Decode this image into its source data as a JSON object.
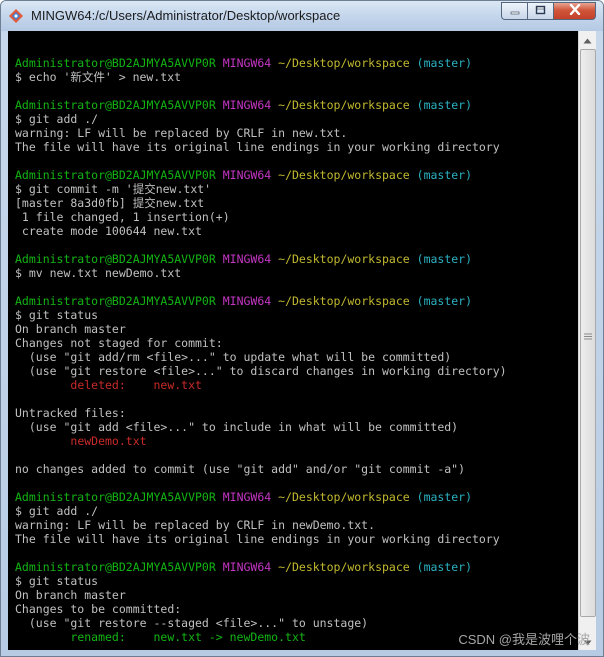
{
  "window": {
    "title": "MINGW64:/c/Users/Administrator/Desktop/workspace"
  },
  "icons": {
    "app": "git-bash-diamond-icon",
    "minimize": "minimize-icon",
    "maximize": "maximize-icon",
    "close": "close-icon",
    "scroll_up": "scroll-up-arrow-icon",
    "scroll_down": "scroll-down-arrow-icon"
  },
  "colors": {
    "prompt_user": "#13b513",
    "prompt_shell": "#c436c4",
    "prompt_path": "#c2b92f",
    "prompt_branch": "#2bb1c1",
    "git_status_highlight": "#c92a2a",
    "default_text": "#c0c0c0",
    "background": "#000000"
  },
  "terminal": {
    "lines": [
      [],
      [
        {
          "t": "Administrator@BD2AJMYA5AVVP0R",
          "c": "green"
        },
        {
          "t": " "
        },
        {
          "t": "MINGW64",
          "c": "magenta"
        },
        {
          "t": " "
        },
        {
          "t": "~/Desktop/workspace",
          "c": "yellow"
        },
        {
          "t": " "
        },
        {
          "t": "(master)",
          "c": "cyan"
        }
      ],
      [
        {
          "t": "$ echo '新文件' > new.txt"
        }
      ],
      [],
      [
        {
          "t": "Administrator@BD2AJMYA5AVVP0R",
          "c": "green"
        },
        {
          "t": " "
        },
        {
          "t": "MINGW64",
          "c": "magenta"
        },
        {
          "t": " "
        },
        {
          "t": "~/Desktop/workspace",
          "c": "yellow"
        },
        {
          "t": " "
        },
        {
          "t": "(master)",
          "c": "cyan"
        }
      ],
      [
        {
          "t": "$ git add ./"
        }
      ],
      [
        {
          "t": "warning: LF will be replaced by CRLF in new.txt."
        }
      ],
      [
        {
          "t": "The file will have its original line endings in your working directory"
        }
      ],
      [],
      [
        {
          "t": "Administrator@BD2AJMYA5AVVP0R",
          "c": "green"
        },
        {
          "t": " "
        },
        {
          "t": "MINGW64",
          "c": "magenta"
        },
        {
          "t": " "
        },
        {
          "t": "~/Desktop/workspace",
          "c": "yellow"
        },
        {
          "t": " "
        },
        {
          "t": "(master)",
          "c": "cyan"
        }
      ],
      [
        {
          "t": "$ git commit -m '提交new.txt'"
        }
      ],
      [
        {
          "t": "[master 8a3d0fb] 提交new.txt"
        }
      ],
      [
        {
          "t": " 1 file changed, 1 insertion(+)"
        }
      ],
      [
        {
          "t": " create mode 100644 new.txt"
        }
      ],
      [],
      [
        {
          "t": "Administrator@BD2AJMYA5AVVP0R",
          "c": "green"
        },
        {
          "t": " "
        },
        {
          "t": "MINGW64",
          "c": "magenta"
        },
        {
          "t": " "
        },
        {
          "t": "~/Desktop/workspace",
          "c": "yellow"
        },
        {
          "t": " "
        },
        {
          "t": "(master)",
          "c": "cyan"
        }
      ],
      [
        {
          "t": "$ mv new.txt newDemo.txt"
        }
      ],
      [],
      [
        {
          "t": "Administrator@BD2AJMYA5AVVP0R",
          "c": "green"
        },
        {
          "t": " "
        },
        {
          "t": "MINGW64",
          "c": "magenta"
        },
        {
          "t": " "
        },
        {
          "t": "~/Desktop/workspace",
          "c": "yellow"
        },
        {
          "t": " "
        },
        {
          "t": "(master)",
          "c": "cyan"
        }
      ],
      [
        {
          "t": "$ git status"
        }
      ],
      [
        {
          "t": "On branch master"
        }
      ],
      [
        {
          "t": "Changes not staged for commit:"
        }
      ],
      [
        {
          "t": "  (use \"git add/rm <file>...\" to update what will be committed)"
        }
      ],
      [
        {
          "t": "  (use \"git restore <file>...\" to discard changes in working directory)"
        }
      ],
      [
        {
          "t": "        "
        },
        {
          "t": "deleted:    new.txt",
          "c": "red"
        }
      ],
      [],
      [
        {
          "t": "Untracked files:"
        }
      ],
      [
        {
          "t": "  (use \"git add <file>...\" to include in what will be committed)"
        }
      ],
      [
        {
          "t": "        "
        },
        {
          "t": "newDemo.txt",
          "c": "red"
        }
      ],
      [],
      [
        {
          "t": "no changes added to commit (use \"git add\" and/or \"git commit -a\")"
        }
      ],
      [],
      [
        {
          "t": "Administrator@BD2AJMYA5AVVP0R",
          "c": "green"
        },
        {
          "t": " "
        },
        {
          "t": "MINGW64",
          "c": "magenta"
        },
        {
          "t": " "
        },
        {
          "t": "~/Desktop/workspace",
          "c": "yellow"
        },
        {
          "t": " "
        },
        {
          "t": "(master)",
          "c": "cyan"
        }
      ],
      [
        {
          "t": "$ git add ./"
        }
      ],
      [
        {
          "t": "warning: LF will be replaced by CRLF in newDemo.txt."
        }
      ],
      [
        {
          "t": "The file will have its original line endings in your working directory"
        }
      ],
      [],
      [
        {
          "t": "Administrator@BD2AJMYA5AVVP0R",
          "c": "green"
        },
        {
          "t": " "
        },
        {
          "t": "MINGW64",
          "c": "magenta"
        },
        {
          "t": " "
        },
        {
          "t": "~/Desktop/workspace",
          "c": "yellow"
        },
        {
          "t": " "
        },
        {
          "t": "(master)",
          "c": "cyan"
        }
      ],
      [
        {
          "t": "$ git status"
        }
      ],
      [
        {
          "t": "On branch master"
        }
      ],
      [
        {
          "t": "Changes to be committed:"
        }
      ],
      [
        {
          "t": "  (use \"git restore --staged <file>...\" to unstage)"
        }
      ],
      [
        {
          "t": "        "
        },
        {
          "t": "renamed:    new.txt -> newDemo.txt",
          "c": "green"
        }
      ]
    ]
  },
  "watermark": "CSDN @我是波哩个波"
}
